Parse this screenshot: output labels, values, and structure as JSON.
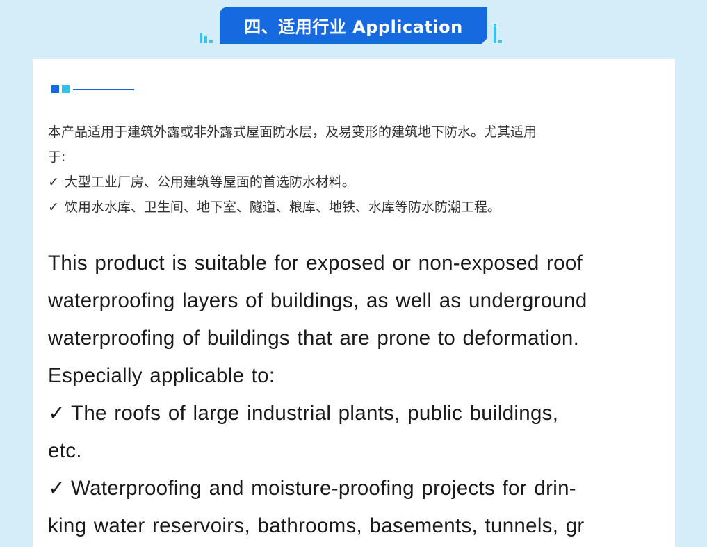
{
  "header": {
    "title": "四、适用行业 Application"
  },
  "icons": {
    "check": "✓"
  },
  "colors": {
    "background": "#d5ecf9",
    "accent": "#1769e0",
    "accent_light": "#2fc3ee"
  },
  "content": {
    "cn_lines": [
      "本产品适用于建筑外露或非外露式屋面防水层，及易变形的建筑地下防水。尤其适用",
      "于:"
    ],
    "cn_items": [
      "大型工业厂房、公用建筑等屋面的首选防水材料。",
      "饮用水水库、卫生间、地下室、隧道、粮库、地铁、水库等防水防潮工程。"
    ],
    "en_lines": [
      "This product is suitable for exposed or non-exposed  roof",
      "waterproofing layers of buildings, as well as underground",
      "waterproofing  of buildings  that are prone to deformation.",
      "Especially applicable to:"
    ],
    "en_item1_line1": "The roofs of  large industrial  plants,  public  buildings,",
    "en_item1_line2": "etc.",
    "en_item2_line1": "Waterproofing and moisture-proofing projects for drin-",
    "en_item2_line2": "king water reservoirs, bathrooms, basements, tunnels, gr"
  }
}
